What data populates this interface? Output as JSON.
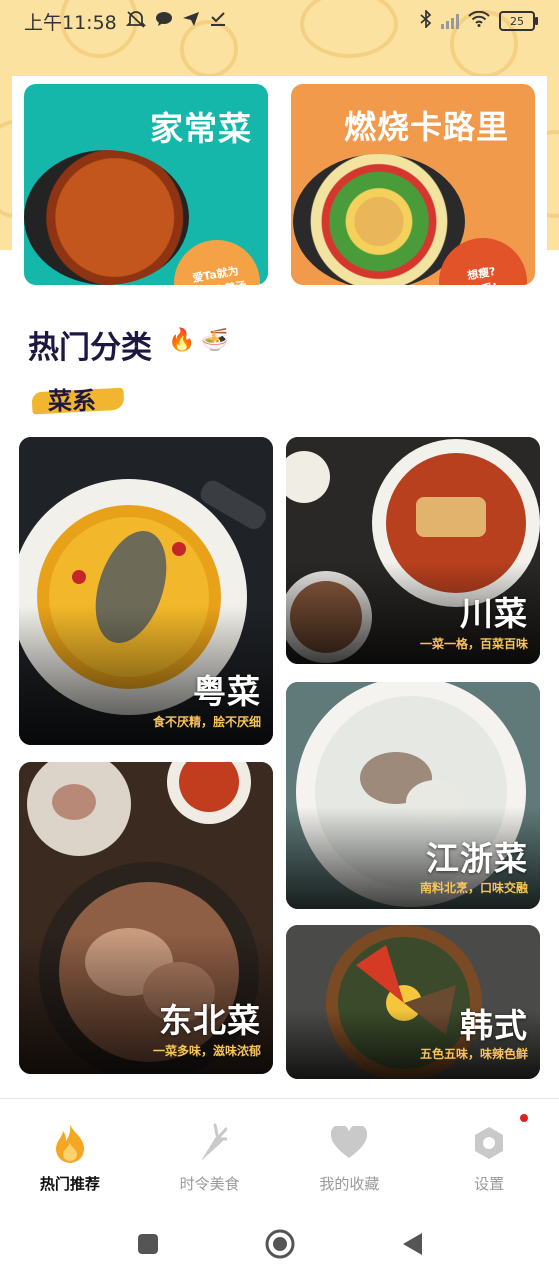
{
  "status_bar": {
    "time": "上午11:58",
    "battery": "25",
    "icons": [
      "mute-icon",
      "chat-bubble-icon",
      "send-icon",
      "check-icon",
      "bluetooth-icon",
      "signal-icon",
      "wifi-icon",
      "battery-icon"
    ]
  },
  "banners": [
    {
      "title": "家常菜",
      "badge": "爱Ta就为\nTa手作羹汤",
      "color": "#16b7ab"
    },
    {
      "title": "燃烧卡路里",
      "badge": "想瘦?\n享受!",
      "color": "#f29a4c"
    }
  ],
  "section": {
    "title": "热门分类",
    "emoji_1": "🔥",
    "emoji_2": "🍜",
    "subtitle": "菜系"
  },
  "cuisines": [
    {
      "name": "粤菜",
      "desc": "食不厌精，脍不厌细"
    },
    {
      "name": "川菜",
      "desc": "一菜一格，百菜百味"
    },
    {
      "name": "东北菜",
      "desc": "一菜多味，滋味浓郁"
    },
    {
      "name": "江浙菜",
      "desc": "南料北烹，口味交融"
    },
    {
      "name": "韩式",
      "desc": "五色五味，味辣色鲜"
    }
  ],
  "bottom_nav": {
    "items": [
      {
        "label": "热门推荐",
        "icon": "flame-icon",
        "active": true
      },
      {
        "label": "时令美食",
        "icon": "carrot-icon",
        "active": false
      },
      {
        "label": "我的收藏",
        "icon": "heart-icon",
        "active": false
      },
      {
        "label": "设置",
        "icon": "settings-icon",
        "active": false
      }
    ]
  },
  "colors": {
    "accent_orange": "#f5a623",
    "brush_yellow": "#f2b52f",
    "title_navy": "#1d1741",
    "desc_yellow": "#f7c35a",
    "top_bg": "#fbe2a1"
  }
}
